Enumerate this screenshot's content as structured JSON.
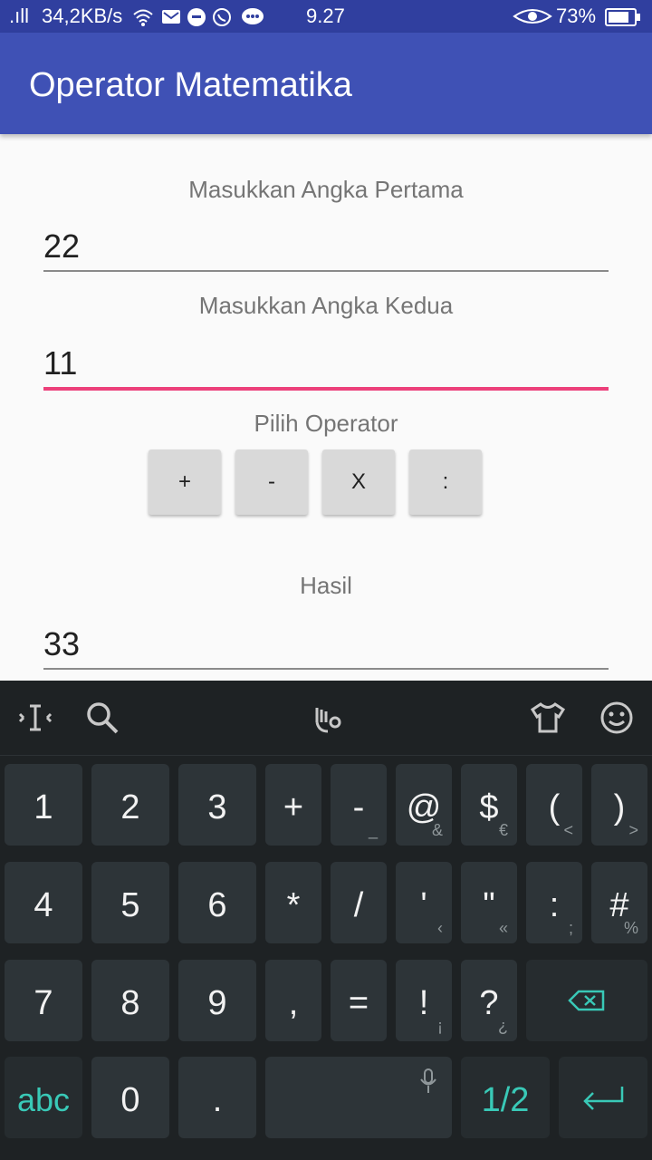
{
  "status_bar": {
    "signal": ".ıll",
    "speed": "34,2KB/s",
    "time": "9.27",
    "battery": "73%"
  },
  "app": {
    "title": "Operator Matematika"
  },
  "form": {
    "first_label": "Masukkan Angka Pertama",
    "first_value": "22",
    "second_label": "Masukkan Angka Kedua",
    "second_value": "11",
    "operator_label": "Pilih Operator",
    "operators": [
      "+",
      "-",
      "X",
      ":"
    ],
    "result_label": "Hasil",
    "result_value": "33"
  },
  "keyboard": {
    "row1": [
      {
        "main": "1"
      },
      {
        "main": "2"
      },
      {
        "main": "3"
      },
      {
        "main": "+"
      },
      {
        "main": "-",
        "sub": "_"
      },
      {
        "main": "@",
        "sub": "&"
      },
      {
        "main": "$",
        "sub": "€"
      },
      {
        "main": "(",
        "sub": "<"
      },
      {
        "main": ")",
        "sub": ">"
      }
    ],
    "row2": [
      {
        "main": "4"
      },
      {
        "main": "5"
      },
      {
        "main": "6"
      },
      {
        "main": "*"
      },
      {
        "main": "/"
      },
      {
        "main": "'",
        "sub": "‹"
      },
      {
        "main": "\"",
        "sub": "«"
      },
      {
        "main": ":",
        "sub": ";"
      },
      {
        "main": "#",
        "sub": "%"
      }
    ],
    "row3": [
      {
        "main": "7"
      },
      {
        "main": "8"
      },
      {
        "main": "9"
      },
      {
        "main": ","
      },
      {
        "main": "="
      },
      {
        "main": "!",
        "sub": "¡"
      },
      {
        "main": "?",
        "sub": "¿"
      }
    ],
    "row4": {
      "abc": "abc",
      "zero": "0",
      "dot": ".",
      "page": "1/2"
    },
    "accent": "#39c9b7"
  }
}
